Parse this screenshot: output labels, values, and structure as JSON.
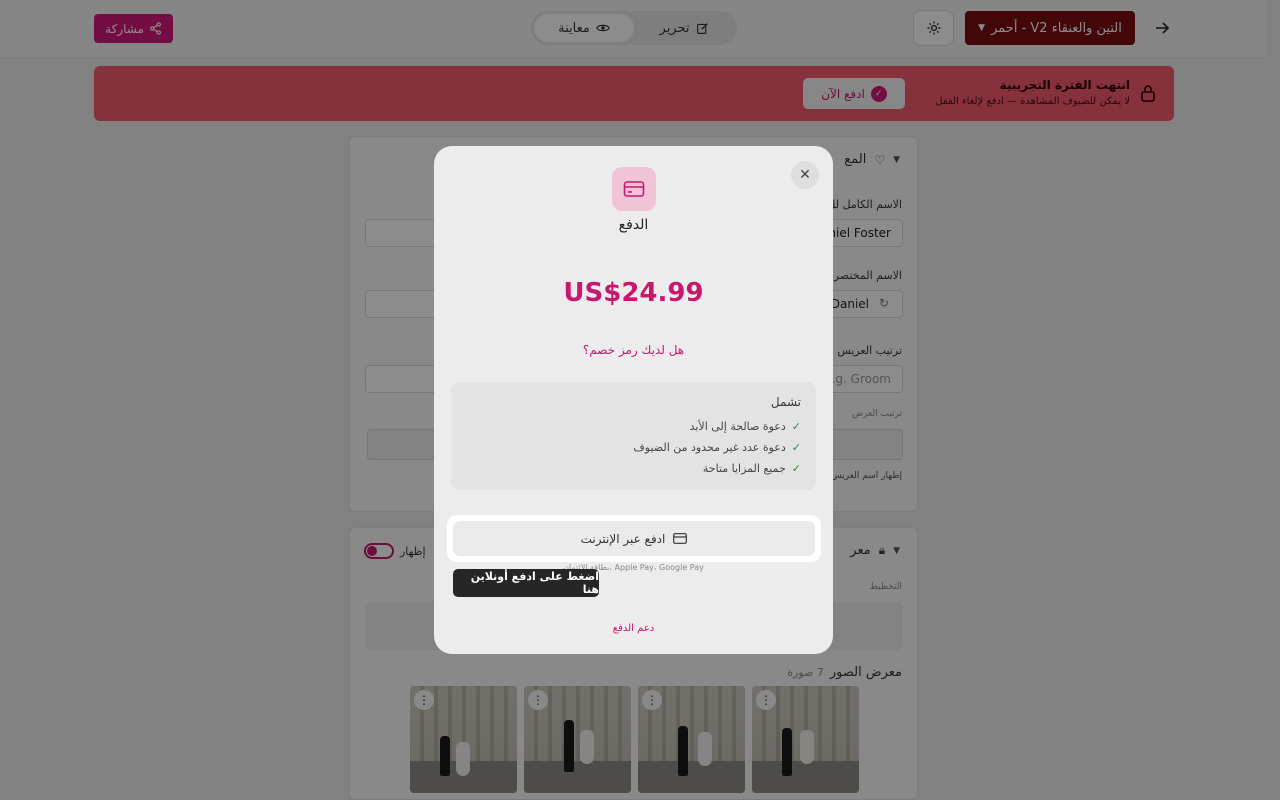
{
  "header": {
    "share_label": "مشاركة",
    "tab_edit": "تحرير",
    "tab_preview": "معاينة",
    "theme_name": "التين والعنقاء V2 - أحمر"
  },
  "banner": {
    "title": "انتهت الفترة التجريبية",
    "subtitle": "لا يمكن للضيوف المشاهدة — ادفع لإلغاء القفل",
    "pay_now_label": "ادفع الآن"
  },
  "form": {
    "section_title": "المع",
    "full_name_label": "الاسم الكامل لل",
    "full_name_value": "aniel Foster",
    "short_name_label": "الاسم المختصر ل",
    "short_name_value": "Daniel",
    "groom_order_label": "ترتيب العريس بي",
    "groom_order_placeholder": "e.g. Groom",
    "groom_order_hint": "ترتيب العرض",
    "show_groom_name": "إظهار اسم العريس"
  },
  "gallery_section": {
    "section_title": "معر",
    "show_toggle_label": "إظهار",
    "layout_label": "التخطيط",
    "gallery_label": "معرض الصور",
    "photo_count": "7 صورة"
  },
  "modal": {
    "title": "الدفع",
    "price": "US$24.99",
    "discount_link": "هل لديك رمز خصم؟",
    "includes_title": "تشمل",
    "includes": [
      "دعوة صالحة إلى الأبد",
      "دعوة عدد غير محدود من الضيوف",
      "جميع المزايا متاحة"
    ],
    "pay_online_label": "ادفع عبر الإنترنت",
    "methods": "بطاقة الائتمان، Apple Pay، Google Pay",
    "tooltip": "اضغط على ادفع أونلاين هنا",
    "support_link": "دعم الدفع"
  },
  "colors": {
    "accent": "#d4187a",
    "banner": "#f45a6d",
    "theme_pill": "#7a0c12"
  }
}
